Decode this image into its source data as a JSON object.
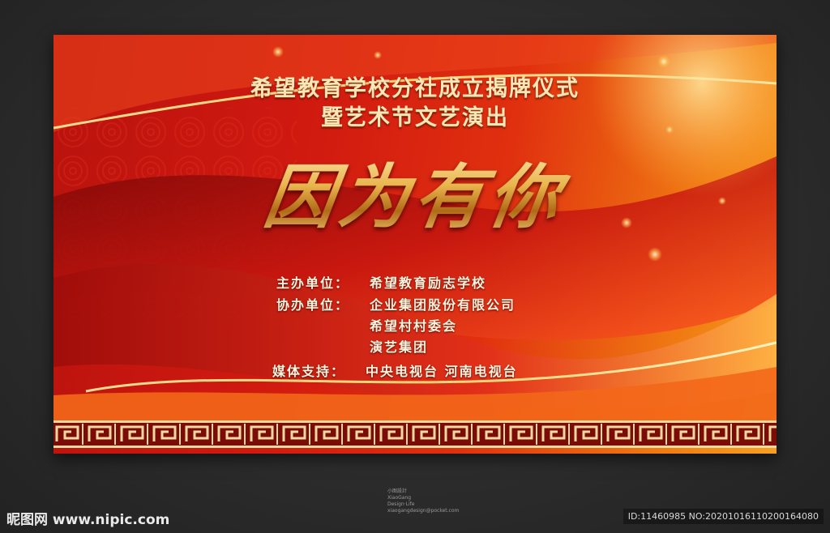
{
  "poster": {
    "title_line1": "希望教育学校分社成立揭牌仪式",
    "title_line2": "暨艺术节文艺演出",
    "calligraphy": "因为有你",
    "organizer_label": "主办单位：",
    "organizer": "希望教育励志学校",
    "co_organizer_label": "协办单位：",
    "co_organizers": [
      "企业集团股份有限公司",
      "希望村村委会",
      "演艺集团"
    ],
    "media_label": "媒体支持：",
    "media": "中央电视台  河南电视台"
  },
  "studio": {
    "name_cn": "小图設計",
    "name_en": "XiaoGang",
    "tagline": "Design·Life",
    "url": "xiaogangdesign@pocket.com"
  },
  "footer": {
    "site_logo": "昵图网 www.nipic.com",
    "image_id": "ID:11460985 NO:20201016110200164080"
  },
  "colors": {
    "primary_red": "#d11a10",
    "accent_gold": "#f2c86a",
    "page_bg": "#2b2b2b"
  }
}
